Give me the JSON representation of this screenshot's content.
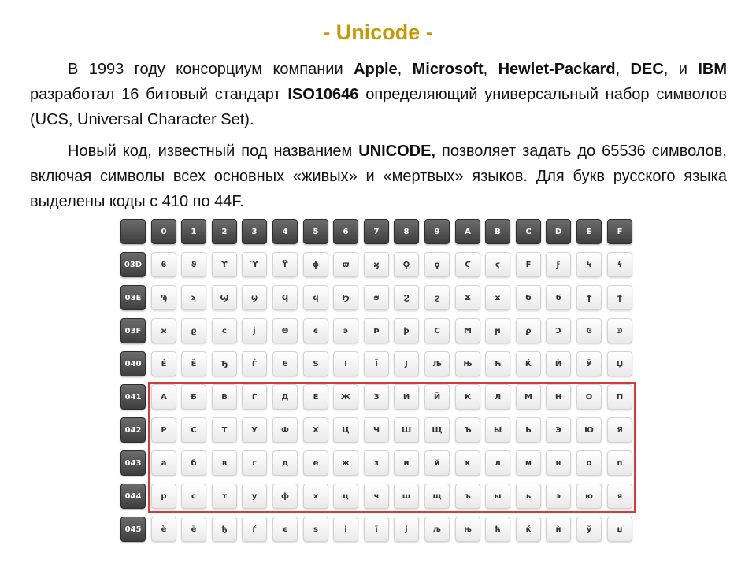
{
  "title": "- Unicode -",
  "paragraph1": [
    {
      "t": "В 1993 году консорциум компании ",
      "b": false
    },
    {
      "t": "Apple",
      "b": true
    },
    {
      "t": ", ",
      "b": false
    },
    {
      "t": "Microsoft",
      "b": true
    },
    {
      "t": ", ",
      "b": false
    },
    {
      "t": "Hewlet-Packard",
      "b": true
    },
    {
      "t": ", ",
      "b": false
    },
    {
      "t": "DEC",
      "b": true
    },
    {
      "t": ", и ",
      "b": false
    },
    {
      "t": "IBM",
      "b": true
    },
    {
      "t": " разработал 16 битовый стандарт ",
      "b": false
    },
    {
      "t": "ISO10646",
      "b": true
    },
    {
      "t": " определяющий универсальный набор символов (UCS, Universal Character Set).",
      "b": false
    }
  ],
  "paragraph2": [
    {
      "t": "Новый код, известный под названием ",
      "b": false
    },
    {
      "t": "UNICODE,",
      "b": true
    },
    {
      "t": " позволяет задать до 65536 символов, включая символы всех основных «живых» и «мертвых» языков. Для букв русского языка выделены коды с 410 по 44F.",
      "b": false
    }
  ],
  "table": {
    "corner": "",
    "columns": [
      "0",
      "1",
      "2",
      "3",
      "4",
      "5",
      "6",
      "7",
      "8",
      "9",
      "A",
      "B",
      "C",
      "D",
      "E",
      "F"
    ],
    "rows": [
      {
        "code": "03D",
        "chars": [
          "ϐ",
          "ϑ",
          "ϒ",
          "ϓ",
          "ϔ",
          "ϕ",
          "ϖ",
          "ϗ",
          "Ϙ",
          "ϙ",
          "Ϛ",
          "ϛ",
          "Ϝ",
          "ϝ",
          "Ϟ",
          "ϟ"
        ]
      },
      {
        "code": "03E",
        "chars": [
          "Ϡ",
          "ϡ",
          "Ϣ",
          "ϣ",
          "Ϥ",
          "ϥ",
          "Ϧ",
          "ϧ",
          "Ϩ",
          "ϩ",
          "Ϫ",
          "ϫ",
          "Ϭ",
          "ϭ",
          "Ϯ",
          "ϯ"
        ]
      },
      {
        "code": "03F",
        "chars": [
          "ϰ",
          "ϱ",
          "ϲ",
          "ϳ",
          "ϴ",
          "ϵ",
          "϶",
          "Ϸ",
          "ϸ",
          "Ϲ",
          "Ϻ",
          "ϻ",
          "ϼ",
          "Ͻ",
          "Ͼ",
          "Ͽ"
        ]
      },
      {
        "code": "040",
        "chars": [
          "Ѐ",
          "Ё",
          "Ђ",
          "Ѓ",
          "Є",
          "Ѕ",
          "І",
          "Ї",
          "Ј",
          "Љ",
          "Њ",
          "Ћ",
          "Ќ",
          "Ѝ",
          "Ў",
          "Џ"
        ]
      },
      {
        "code": "041",
        "chars": [
          "А",
          "Б",
          "В",
          "Г",
          "Д",
          "Е",
          "Ж",
          "З",
          "И",
          "Й",
          "К",
          "Л",
          "М",
          "Н",
          "О",
          "П"
        ]
      },
      {
        "code": "042",
        "chars": [
          "Р",
          "С",
          "Т",
          "У",
          "Ф",
          "Х",
          "Ц",
          "Ч",
          "Ш",
          "Щ",
          "Ъ",
          "Ы",
          "Ь",
          "Э",
          "Ю",
          "Я"
        ]
      },
      {
        "code": "043",
        "chars": [
          "а",
          "б",
          "в",
          "г",
          "д",
          "е",
          "ж",
          "з",
          "и",
          "й",
          "к",
          "л",
          "м",
          "н",
          "о",
          "п"
        ]
      },
      {
        "code": "044",
        "chars": [
          "р",
          "с",
          "т",
          "у",
          "ф",
          "х",
          "ц",
          "ч",
          "ш",
          "щ",
          "ъ",
          "ы",
          "ь",
          "э",
          "ю",
          "я"
        ]
      },
      {
        "code": "045",
        "chars": [
          "ѐ",
          "ё",
          "ђ",
          "ѓ",
          "є",
          "ѕ",
          "і",
          "ї",
          "ј",
          "љ",
          "њ",
          "ћ",
          "ќ",
          "ѝ",
          "ў",
          "џ"
        ]
      }
    ],
    "highlight_color": "#d33a3a"
  }
}
